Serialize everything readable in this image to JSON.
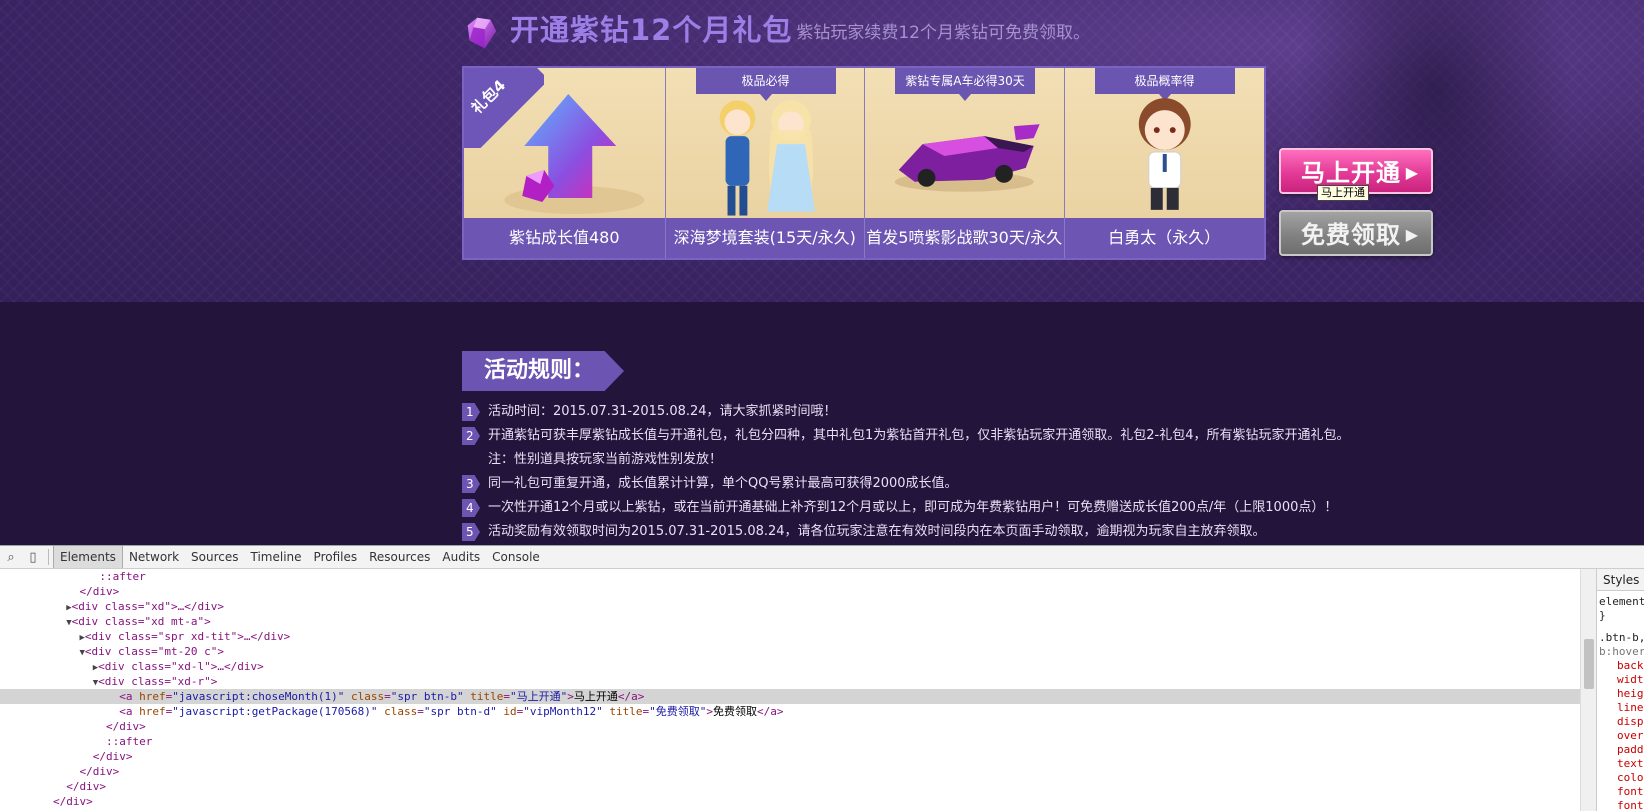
{
  "header": {
    "main_title": "开通紫钻12个月礼包",
    "subtitle": "紫钻玩家续费12个月紫钻可免费领取。"
  },
  "gift_panel": {
    "corner_label": "礼包4",
    "items": [
      {
        "tag": "",
        "label": "紫钻成长值480"
      },
      {
        "tag": "极品必得",
        "label": "深海梦境套装(15天/永久)"
      },
      {
        "tag": "紫钻专属A车必得30天",
        "label": "首发5喷紫影战歌30天/永久"
      },
      {
        "tag": "极品概率得",
        "label": "白勇太（永久）"
      }
    ]
  },
  "buttons": {
    "open_label": "马上开通",
    "free_label": "免费领取",
    "tooltip": "马上开通"
  },
  "rules": {
    "heading": "活动规则：",
    "items": [
      {
        "num": "1",
        "text": "活动时间：2015.07.31-2015.08.24，请大家抓紧时间哦！"
      },
      {
        "num": "2",
        "text": "开通紫钻可获丰厚紫钻成长值与开通礼包，礼包分四种，其中礼包1为紫钻首开礼包，仅非紫钻玩家开通领取。礼包2-礼包4，所有紫钻玩家开通礼包。"
      },
      {
        "num": "",
        "text": "注：性别道具按玩家当前游戏性别发放！"
      },
      {
        "num": "3",
        "text": "同一礼包可重复开通，成长值累计计算，单个QQ号累计最高可获得2000成长值。"
      },
      {
        "num": "4",
        "text": "一次性开通12个月或以上紫钻，或在当前开通基础上补齐到12个月或以上，即可成为年费紫钻用户！可免费赠送成长值200点/年（上限1000点）！"
      },
      {
        "num": "5",
        "text": "活动奖励有效领取时间为2015.07.31-2015.08.24，请各位玩家注意在有效时间段内在本页面手动领取，逾期视为玩家自主放弃领取。"
      }
    ]
  },
  "devtools": {
    "tabs": [
      "Elements",
      "Network",
      "Sources",
      "Timeline",
      "Profiles",
      "Resources",
      "Audits",
      "Console"
    ],
    "active_tab": "Elements",
    "tree": {
      "l0": "::after",
      "l1": "</div>",
      "l2_tag": "<div class=\"xd\">…</div>",
      "l3_tag": "<div class=\"xd mt-a\">",
      "l4_tag": "<div class=\"spr xd-tit\">…</div>",
      "l5_tag": "<div class=\"mt-20 c\">",
      "l6_tag": "<div class=\"xd-l\">…</div>",
      "l7_tag": "<div class=\"xd-r\">",
      "a1_open": "<a ",
      "a1_href_attr": "href",
      "a1_href_val": "\"javascript:choseMonth(1)\"",
      "a1_class_attr": "class",
      "a1_class_val": "\"spr btn-b\"",
      "a1_title_attr": "title",
      "a1_title_val": "\"马上开通\"",
      "a1_text": "马上开通",
      "a1_close": "</a>",
      "a2_href_val": "\"javascript:getPackage(170568)\"",
      "a2_class_val": "\"spr btn-d\"",
      "a2_id_attr": "id",
      "a2_id_val": "\"vipMonth12\"",
      "a2_title_val": "\"免费领取\"",
      "a2_text": "免费领取",
      "close_div": "</div>",
      "after": "::after"
    },
    "styles": {
      "tab": "Styles",
      "l1": "element",
      "l2": "}",
      "l3": ".btn-b,",
      "l4": "b:hover",
      "props": [
        "back",
        "widt",
        "heig",
        "line",
        "disp",
        "over",
        "padd",
        "text",
        "colo",
        "font",
        "font"
      ]
    }
  }
}
